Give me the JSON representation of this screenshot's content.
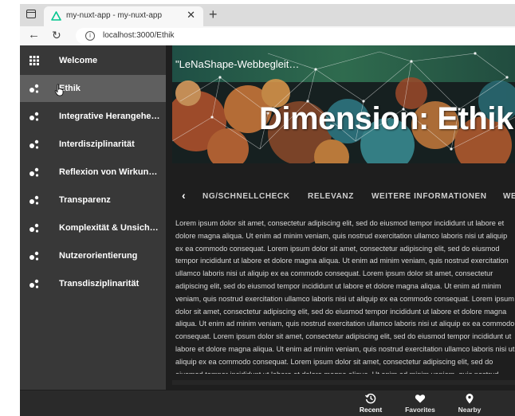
{
  "browser": {
    "tab_title": "my-nuxt-app - my-nuxt-app",
    "tab_close": "✕",
    "new_tab": "+",
    "url": "localhost:3000/Ethik",
    "back": "←",
    "reload": "↻",
    "info": "i"
  },
  "sidebar": {
    "items": [
      {
        "label": "Welcome",
        "icon": "grid-icon"
      },
      {
        "label": "Ethik",
        "icon": "molecule-icon",
        "active": true
      },
      {
        "label": "Integrative Herangehe…",
        "icon": "molecule-icon"
      },
      {
        "label": "Interdisziplinarität",
        "icon": "molecule-icon"
      },
      {
        "label": "Reflexion von Wirkun…",
        "icon": "molecule-icon"
      },
      {
        "label": "Transparenz",
        "icon": "molecule-icon"
      },
      {
        "label": "Komplexität & Unsich…",
        "icon": "molecule-icon"
      },
      {
        "label": "Nutzerorientierung",
        "icon": "molecule-icon"
      },
      {
        "label": "Transdisziplinarität",
        "icon": "molecule-icon"
      }
    ]
  },
  "hero": {
    "toolbar_title": "\"LeNaShape-Webbegleit…",
    "title": "Dimension: Ethik"
  },
  "tabs": {
    "prev": "‹",
    "items": [
      "NG/SCHNELLCHECK",
      "RELEVANZ",
      "WEITERE INFORMATIONEN",
      "WE"
    ]
  },
  "content": {
    "body": "Lorem ipsum dolor sit amet, consectetur adipiscing elit, sed do eiusmod tempor incididunt ut labore et dolore magna aliqua. Ut enim ad minim veniam, quis nostrud exercitation ullamco laboris nisi ut aliquip ex ea commodo consequat. Lorem ipsum dolor sit amet, consectetur adipiscing elit, sed do eiusmod tempor incididunt ut labore et dolore magna aliqua. Ut enim ad minim veniam, quis nostrud exercitation ullamco laboris nisi ut aliquip ex ea commodo consequat. Lorem ipsum dolor sit amet, consectetur adipiscing elit, sed do eiusmod tempor incididunt ut labore et dolore magna aliqua. Ut enim ad minim veniam, quis nostrud exercitation ullamco laboris nisi ut aliquip ex ea commodo consequat. Lorem ipsum dolor sit amet, consectetur adipiscing elit, sed do eiusmod tempor incididunt ut labore et dolore magna aliqua. Ut enim ad minim veniam, quis nostrud exercitation ullamco laboris nisi ut aliquip ex ea commodo consequat. Lorem ipsum dolor sit amet, consectetur adipiscing elit, sed do eiusmod tempor incididunt ut labore et dolore magna aliqua. Ut enim ad minim veniam, quis nostrud exercitation ullamco laboris nisi ut aliquip ex ea commodo consequat. Lorem ipsum dolor sit amet, consectetur adipiscing elit, sed do eiusmod tempor incididunt ut labore et dolore magna aliqua. Ut enim ad minim veniam, quis nostrud exercitation ullamco laboris nisi ut aliquip ex ea commodo consequat."
  },
  "bottom_nav": {
    "items": [
      {
        "label": "Recent",
        "icon": "history-icon",
        "active": true
      },
      {
        "label": "Favorites",
        "icon": "heart-icon"
      },
      {
        "label": "Nearby",
        "icon": "location-pin-icon"
      }
    ]
  },
  "colors": {
    "sidebar_bg": "#383838",
    "sidebar_active": "#5f5f5f",
    "app_bg": "#1e1e1e",
    "nuxt_green": "#00c58e"
  }
}
